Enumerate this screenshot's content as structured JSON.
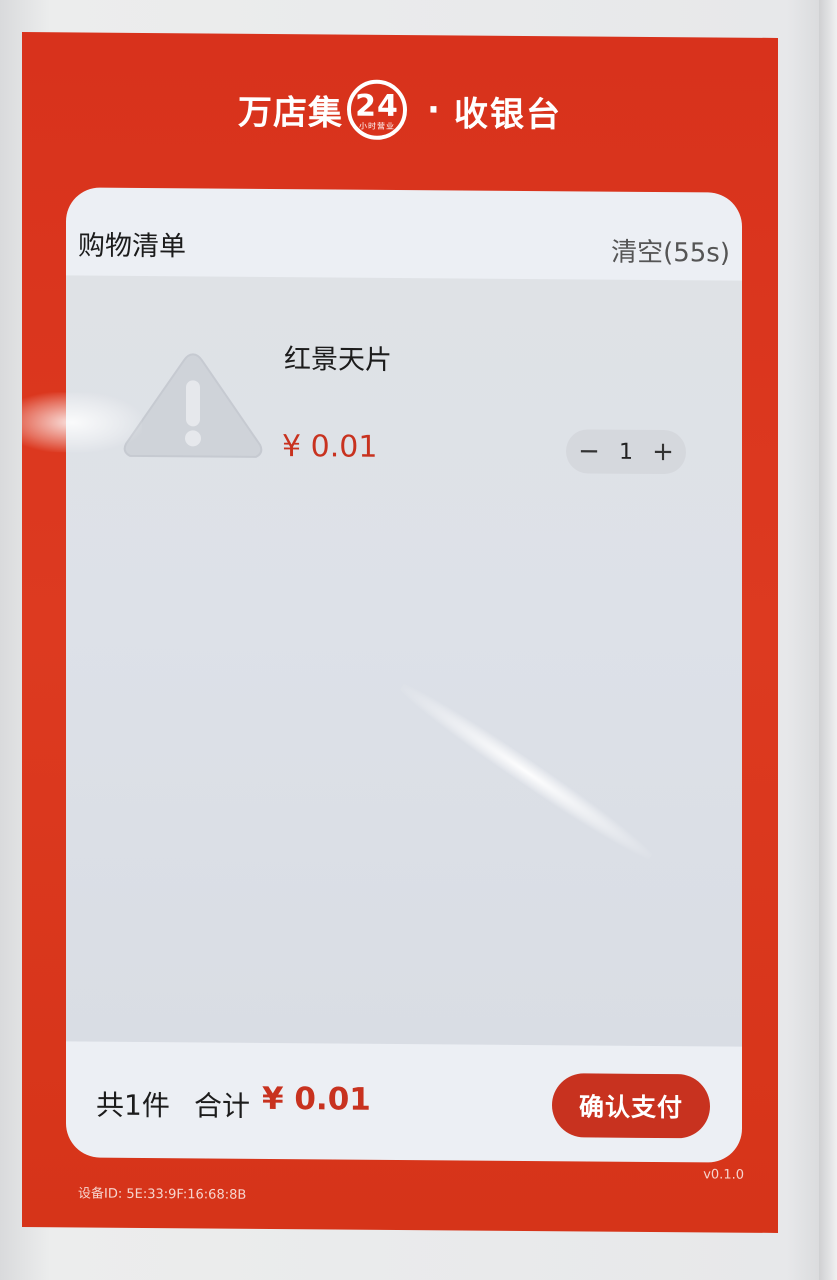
{
  "header": {
    "brand_name": "万店集",
    "brand_number": "24",
    "brand_number_subtitle": "小时营业",
    "separator": "·",
    "title": "收银台"
  },
  "cart": {
    "title": "购物清单",
    "clear_label": "清空(55s)",
    "items": [
      {
        "name": "红景天片",
        "price": "¥ 0.01",
        "quantity": "1",
        "decrement_label": "−",
        "increment_label": "+",
        "thumbnail_icon": "warning-triangle-icon"
      }
    ]
  },
  "footer": {
    "count_label": "共1件",
    "total_label": "合计",
    "total_value": "¥ 0.01",
    "pay_label": "确认支付"
  },
  "meta": {
    "device_id": "设备ID: 5E:33:9F:16:68:8B",
    "version": "v0.1.0"
  },
  "colors": {
    "brand_red": "#d8321c",
    "accent_red": "#c8321f",
    "card_bg": "#eceff4"
  }
}
